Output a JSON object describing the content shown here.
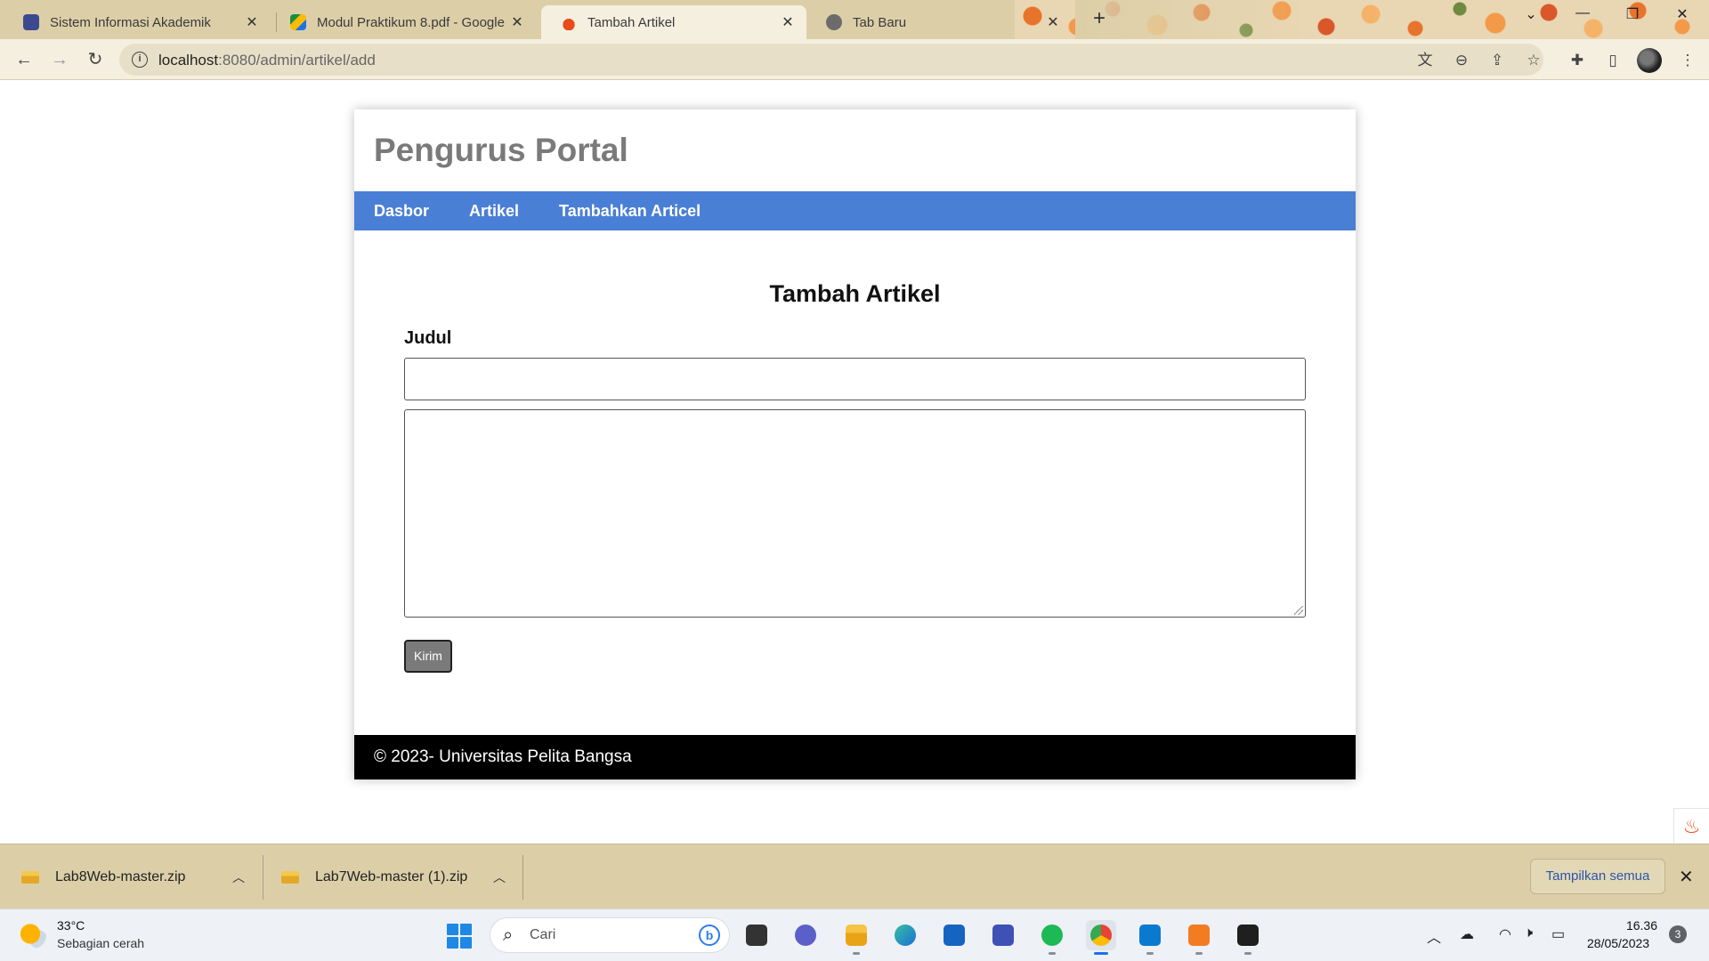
{
  "browser": {
    "tabs": [
      {
        "title": "Sistem Informasi Akademik",
        "active": false
      },
      {
        "title": "Modul Praktikum 8.pdf - Google",
        "active": false
      },
      {
        "title": "Tambah Artikel",
        "active": true
      },
      {
        "title": "Tab Baru",
        "active": false
      }
    ],
    "close_glyph": "✕",
    "new_tab_glyph": "+",
    "url_host": "localhost",
    "url_path": ":8080/admin/artikel/add",
    "toolbar_icons": [
      "back-icon",
      "forward-icon",
      "reload-icon",
      "info-icon",
      "translate-icon",
      "zoom-icon",
      "share-icon",
      "star-icon",
      "extensions-icon",
      "sidepanel-icon",
      "profile-icon",
      "menu-icon"
    ]
  },
  "page": {
    "site_title": "Pengurus Portal",
    "nav": [
      "Dasbor",
      "Artikel",
      "Tambahkan Articel"
    ],
    "heading": "Tambah Artikel",
    "title_label": "Judul",
    "title_value": "",
    "content_value": "",
    "submit_label": "Kirim",
    "footer": "© 2023- Universitas Pelita Bangsa",
    "nav_color": "#4a7fd6"
  },
  "downloads": {
    "items": [
      "Lab8Web-master.zip",
      "Lab7Web-master (1).zip"
    ],
    "show_all": "Tampilkan semua"
  },
  "taskbar": {
    "temperature": "33°C",
    "condition": "Sebagian cerah",
    "search_placeholder": "Cari",
    "time": "16.36",
    "date": "28/05/2023",
    "notifications": "3",
    "apps": [
      "file-icon",
      "meet-icon",
      "explorer-icon",
      "edge-icon",
      "store-icon",
      "editor-icon",
      "spotify-icon",
      "chrome-icon",
      "vscode-icon",
      "xampp-icon",
      "terminal-icon"
    ]
  }
}
